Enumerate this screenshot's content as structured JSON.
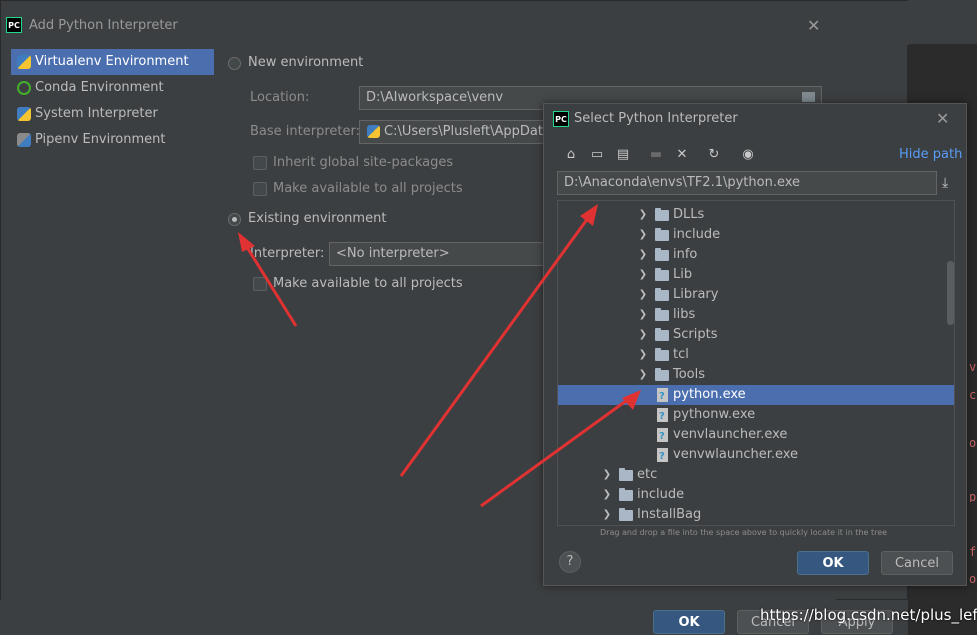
{
  "main_dialog": {
    "title": "Add Python Interpreter",
    "sidebar": [
      {
        "label": "Virtualenv Environment",
        "selected": true,
        "icon": "virtualenv-icon"
      },
      {
        "label": "Conda Environment",
        "selected": false,
        "icon": "conda-icon"
      },
      {
        "label": "System Interpreter",
        "selected": false,
        "icon": "python-icon"
      },
      {
        "label": "Pipenv Environment",
        "selected": false,
        "icon": "pipenv-icon"
      }
    ],
    "new_env": {
      "label": "New environment",
      "location_label": "Location:",
      "location_value": "D:\\AIworkspace\\venv",
      "base_label": "Base interpreter:",
      "base_value": "C:\\Users\\Plusleft\\AppData\\L",
      "inherit_label": "Inherit global site-packages",
      "available_label": "Make available to all projects"
    },
    "existing_env": {
      "label": "Existing environment",
      "interpreter_label": "Interpreter:",
      "interpreter_value": "<No interpreter>",
      "available_label": "Make available to all projects"
    },
    "ok_label": "OK",
    "cancel_label": "Cancel",
    "apply_label": "Apply"
  },
  "select_dialog": {
    "title": "Select Python Interpreter",
    "hide_path_label": "Hide path",
    "path_value": "D:\\Anaconda\\envs\\TF2.1\\python.exe",
    "tree": [
      {
        "label": "DLLs",
        "type": "folder",
        "depth": 2
      },
      {
        "label": "include",
        "type": "folder",
        "depth": 2
      },
      {
        "label": "info",
        "type": "folder",
        "depth": 2
      },
      {
        "label": "Lib",
        "type": "folder",
        "depth": 2
      },
      {
        "label": "Library",
        "type": "folder",
        "depth": 2
      },
      {
        "label": "libs",
        "type": "folder",
        "depth": 2
      },
      {
        "label": "Scripts",
        "type": "folder",
        "depth": 2
      },
      {
        "label": "tcl",
        "type": "folder",
        "depth": 2
      },
      {
        "label": "Tools",
        "type": "folder",
        "depth": 2
      },
      {
        "label": "python.exe",
        "type": "file",
        "depth": 2,
        "selected": true
      },
      {
        "label": "pythonw.exe",
        "type": "file",
        "depth": 2
      },
      {
        "label": "venvlauncher.exe",
        "type": "file",
        "depth": 2
      },
      {
        "label": "venvwlauncher.exe",
        "type": "file",
        "depth": 2
      },
      {
        "label": "etc",
        "type": "folder",
        "depth": 1
      },
      {
        "label": "include",
        "type": "folder",
        "depth": 1
      },
      {
        "label": "InstallBag",
        "type": "folder",
        "depth": 1
      }
    ],
    "hint": "Drag and drop a file into the space above to quickly locate it in the tree",
    "ok_label": "OK",
    "cancel_label": "Cancel"
  },
  "watermark": "https://blog.csdn.net/plus_left",
  "colors": {
    "accent": "#4b6eaf",
    "arrow": "#e03232",
    "ok_button": "#365880"
  }
}
